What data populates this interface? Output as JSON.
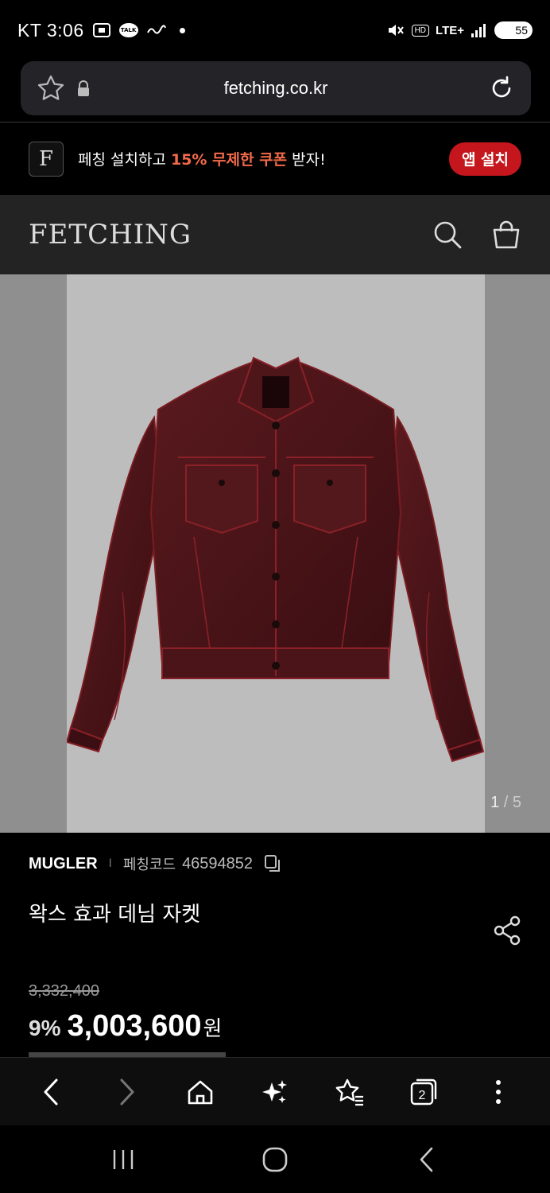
{
  "status_bar": {
    "carrier": "KT",
    "time": "3:06",
    "talk_label": "TALK",
    "hd_label": "HD",
    "network": "LTE+",
    "battery": "55"
  },
  "url_bar": {
    "url": "fetching.co.kr"
  },
  "app_banner": {
    "logo_letter": "F",
    "text_before": "페칭 설치하고 ",
    "text_highlight": "15% 무제한 쿠폰",
    "text_after": " 받자!",
    "install_label": "앱 설치"
  },
  "site_header": {
    "logo": "FETCHING"
  },
  "gallery": {
    "current": "1",
    "separator": "/",
    "total": "5"
  },
  "product": {
    "brand": "MUGLER",
    "separator": "I",
    "code_label": "페칭코드",
    "code_value": "46594852",
    "name": "왁스 효과 데님 자켓",
    "original_price": "3,332,400",
    "discount": "9%",
    "price": "3,003,600",
    "currency": "원"
  },
  "colors": {
    "accent_orange": "#f26a4a",
    "install_red": "#c4161c",
    "header_bg": "#232323"
  },
  "browser_bar": {
    "tab_count": "2"
  }
}
